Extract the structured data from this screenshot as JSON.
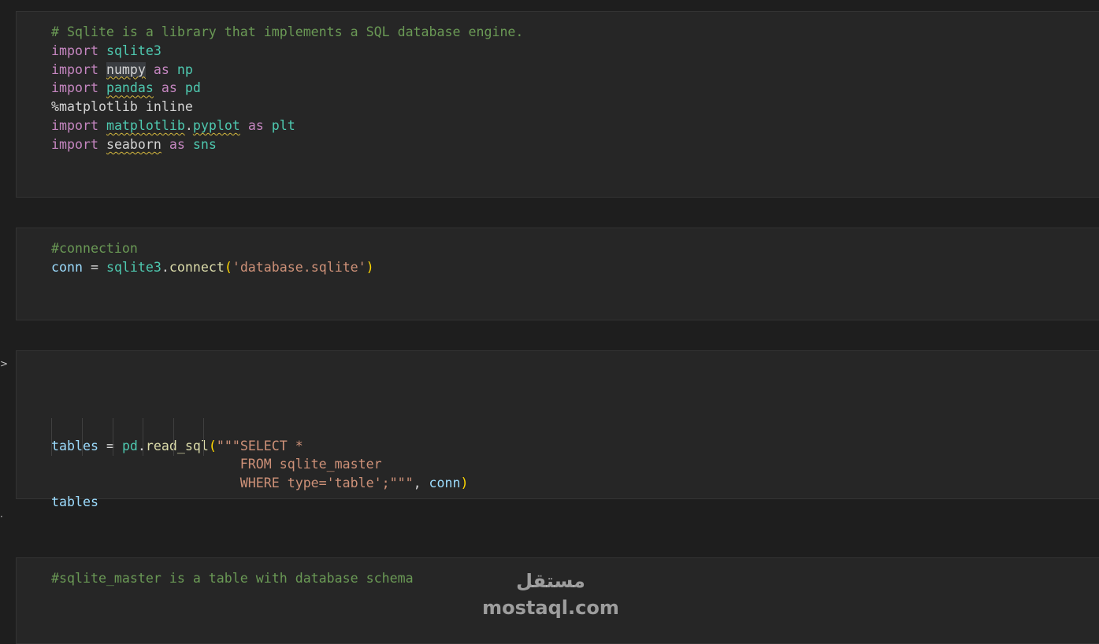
{
  "cells": [
    {
      "id": "cell-1",
      "lines": [
        [
          {
            "t": "# Sqlite is a library that implements a SQL database engine.",
            "c": "cmt"
          }
        ],
        [
          {
            "t": "import",
            "c": "kw"
          },
          {
            "t": " ",
            "c": "plain"
          },
          {
            "t": "sqlite3",
            "c": "mod"
          }
        ],
        [
          {
            "t": "import",
            "c": "kw"
          },
          {
            "t": " ",
            "c": "plain"
          },
          {
            "t": "numpy",
            "c": "plain squig hl"
          },
          {
            "t": " ",
            "c": "plain"
          },
          {
            "t": "as",
            "c": "kw"
          },
          {
            "t": " ",
            "c": "plain"
          },
          {
            "t": "np",
            "c": "mod"
          }
        ],
        [
          {
            "t": "import",
            "c": "kw"
          },
          {
            "t": " ",
            "c": "plain"
          },
          {
            "t": "pandas",
            "c": "mod squig"
          },
          {
            "t": " ",
            "c": "plain"
          },
          {
            "t": "as",
            "c": "kw"
          },
          {
            "t": " ",
            "c": "plain"
          },
          {
            "t": "pd",
            "c": "mod"
          }
        ],
        [
          {
            "t": "%matplotlib inline",
            "c": "plain"
          }
        ],
        [
          {
            "t": "import",
            "c": "kw"
          },
          {
            "t": " ",
            "c": "plain"
          },
          {
            "t": "matplotlib",
            "c": "mod squig"
          },
          {
            "t": ".",
            "c": "plain"
          },
          {
            "t": "pyplot",
            "c": "mod squig"
          },
          {
            "t": " ",
            "c": "plain"
          },
          {
            "t": "as",
            "c": "kw"
          },
          {
            "t": " ",
            "c": "plain"
          },
          {
            "t": "plt",
            "c": "mod"
          }
        ],
        [
          {
            "t": "import",
            "c": "kw"
          },
          {
            "t": " ",
            "c": "plain"
          },
          {
            "t": "seaborn",
            "c": "plain squig"
          },
          {
            "t": " ",
            "c": "plain"
          },
          {
            "t": "as",
            "c": "kw"
          },
          {
            "t": " ",
            "c": "plain"
          },
          {
            "t": "sns",
            "c": "mod"
          }
        ]
      ]
    },
    {
      "id": "cell-2",
      "lines": [
        [
          {
            "t": "#connection",
            "c": "cmt"
          }
        ],
        [
          {
            "t": "conn",
            "c": "var"
          },
          {
            "t": " = ",
            "c": "plain"
          },
          {
            "t": "sqlite3",
            "c": "mod"
          },
          {
            "t": ".",
            "c": "plain"
          },
          {
            "t": "connect",
            "c": "fn"
          },
          {
            "t": "(",
            "c": "paren"
          },
          {
            "t": "'database.sqlite'",
            "c": "str"
          },
          {
            "t": ")",
            "c": "paren"
          }
        ]
      ]
    },
    {
      "id": "cell-3",
      "lines": [
        [
          {
            "t": "tables",
            "c": "var"
          },
          {
            "t": " = ",
            "c": "plain"
          },
          {
            "t": "pd",
            "c": "mod"
          },
          {
            "t": ".",
            "c": "plain"
          },
          {
            "t": "read_sql",
            "c": "fn"
          },
          {
            "t": "(",
            "c": "paren"
          },
          {
            "t": "\"\"\"SELECT *",
            "c": "str"
          }
        ],
        [
          {
            "t": "                        FROM sqlite_master",
            "c": "str"
          }
        ],
        [
          {
            "t": "                        WHERE type='table';\"\"\"",
            "c": "str"
          },
          {
            "t": ", ",
            "c": "plain"
          },
          {
            "t": "conn",
            "c": "var"
          },
          {
            "t": ")",
            "c": "paren"
          }
        ],
        [
          {
            "t": "tables",
            "c": "var"
          }
        ]
      ]
    },
    {
      "id": "cell-4",
      "lines": [
        [
          {
            "t": "#sqlite_master is a table with database schema",
            "c": "cmt"
          }
        ]
      ]
    }
  ],
  "gutter": {
    "run_marker": ">",
    "dot_marker": "."
  },
  "watermark": {
    "arabic": "مستقل",
    "latin": "mostaql.com"
  },
  "colors": {
    "background": "#1e1e1e",
    "cell": "#262626",
    "keyword": "#c586c0",
    "module": "#4ec9b0",
    "variable": "#9cdcfe",
    "function": "#dcdcaa",
    "string": "#ce9178",
    "comment": "#6a9955"
  }
}
